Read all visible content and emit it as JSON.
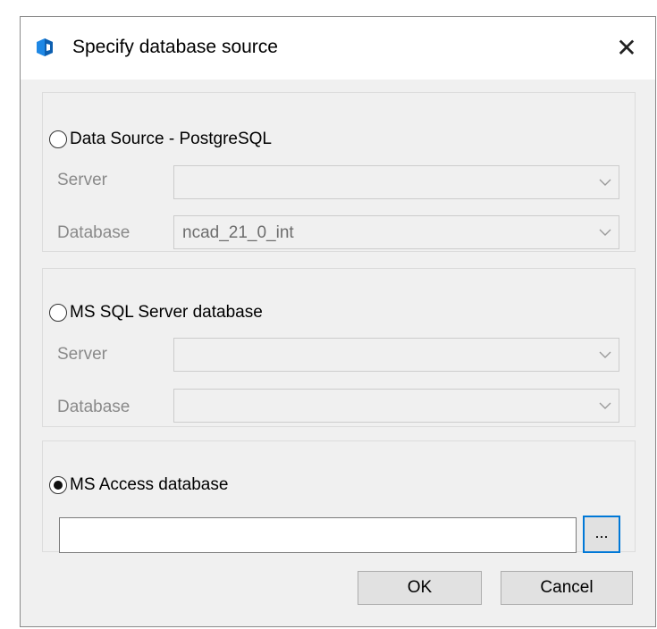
{
  "dialog": {
    "title": "Specify database source",
    "close_label": "✕"
  },
  "postgres": {
    "label": "Data Source - PostgreSQL",
    "selected": false,
    "server_label": "Server",
    "server_value": "",
    "database_label": "Database",
    "database_value": "ncad_21_0_int"
  },
  "mssql": {
    "label": "MS SQL Server database",
    "selected": false,
    "server_label": "Server",
    "server_value": "",
    "database_label": "Database",
    "database_value": ""
  },
  "access": {
    "label": "MS Access database",
    "selected": true,
    "path_value": "",
    "browse_label": "..."
  },
  "buttons": {
    "ok": "OK",
    "cancel": "Cancel"
  },
  "colors": {
    "dialog_bg": "#f0f0f0",
    "accent_focus": "#0078d7",
    "app_icon": "#1e88e5"
  }
}
